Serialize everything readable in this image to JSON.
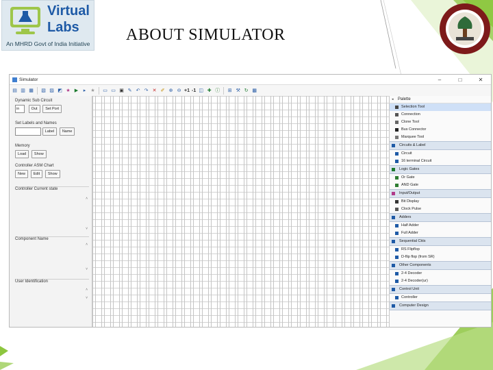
{
  "slide": {
    "title": "ABOUT SIMULATOR",
    "logo": {
      "line1": "Virtual",
      "line2": "Labs",
      "tagline": "An MHRD Govt of India Initiative"
    }
  },
  "window": {
    "title": "Simulator",
    "controls": [
      "–",
      "□",
      "✕"
    ]
  },
  "toolbar": {
    "icons": [
      "new-icon",
      "open-icon",
      "save-icon",
      "export-icon",
      "print-icon",
      "chart-icon",
      "star-icon",
      "run-icon",
      "step-icon",
      "star-outline-icon",
      "layout-icon",
      "layout2-icon",
      "grid-icon",
      "edit-icon",
      "undo-icon",
      "redo-icon",
      "delete-icon",
      "select-icon",
      "zoom-in-icon",
      "zoom-out-icon",
      "plus-one",
      "minus-one",
      "layout3-icon",
      "connect-icon",
      "info-icon",
      "align-icon",
      "tools-icon",
      "refresh-icon",
      "component-icon"
    ],
    "plus_one": "+1",
    "minus_one": "-1"
  },
  "left_panel": {
    "dynamic_sub_circuit": {
      "label": "Dynamic Sub Circuit",
      "in_value": "in",
      "out_label": "Out",
      "set_port_label": "Set Port"
    },
    "set_labels": {
      "label": "Set Labels and Names",
      "label_button": "Label",
      "name_button": "Name"
    },
    "memory": {
      "label": "Memory",
      "load_button": "Load",
      "show_button": "Show"
    },
    "controller_asm": {
      "label": "Controller ASM Chart",
      "new_button": "New",
      "edit_button": "Edit",
      "show_button": "Show"
    },
    "controller_current_state": "Controller Current state",
    "component_name": "Component Name",
    "user_identification": "User Identification"
  },
  "palette": {
    "header": "Palette",
    "rows": [
      {
        "kind": "item",
        "label": "Selection Tool",
        "selected": true,
        "icon": "pointer-icon"
      },
      {
        "kind": "item",
        "label": "Connection",
        "icon": "connection-icon"
      },
      {
        "kind": "item",
        "label": "Clone Tool",
        "icon": "clone-icon"
      },
      {
        "kind": "item",
        "label": "Bus Connector",
        "icon": "bus-icon"
      },
      {
        "kind": "item",
        "label": "Marquee Tool",
        "icon": "marquee-icon"
      },
      {
        "kind": "drawer",
        "label": "Circuits & Label",
        "icon": "circuit-icon"
      },
      {
        "kind": "item",
        "label": "Circuit",
        "icon": "circuit-icon"
      },
      {
        "kind": "item",
        "label": "16 terminal Circuit",
        "icon": "terminal-icon"
      },
      {
        "kind": "drawer",
        "label": "Logic Gates",
        "icon": "gate-icon"
      },
      {
        "kind": "item",
        "label": "Or Gate",
        "icon": "or-gate-icon"
      },
      {
        "kind": "item",
        "label": "AND Gate",
        "icon": "and-gate-icon"
      },
      {
        "kind": "drawer",
        "label": "Input/Output",
        "icon": "io-icon"
      },
      {
        "kind": "item",
        "label": "Bit Display",
        "icon": "display-icon"
      },
      {
        "kind": "item",
        "label": "Clock Pulse",
        "icon": "clock-icon"
      },
      {
        "kind": "drawer",
        "label": "Adders",
        "icon": "adder-icon"
      },
      {
        "kind": "item",
        "label": "Half Adder",
        "icon": "adder-icon"
      },
      {
        "kind": "item",
        "label": "Full Adder",
        "icon": "adder-icon"
      },
      {
        "kind": "drawer",
        "label": "Sequential Ckts",
        "icon": "seq-icon"
      },
      {
        "kind": "item",
        "label": "RS Flipflop",
        "icon": "flipflop-icon"
      },
      {
        "kind": "item",
        "label": "D-flip flop (from SR)",
        "icon": "flipflop-icon"
      },
      {
        "kind": "drawer",
        "label": "Other Components",
        "icon": "component-icon"
      },
      {
        "kind": "item",
        "label": "2-4 Decoder",
        "icon": "decoder-icon"
      },
      {
        "kind": "item",
        "label": "2-4 Decoder(ur)",
        "icon": "decoder-icon"
      },
      {
        "kind": "drawer",
        "label": "Control Unit",
        "icon": "control-icon"
      },
      {
        "kind": "item",
        "label": "Controller",
        "icon": "controller-icon"
      },
      {
        "kind": "drawer",
        "label": "Computer Design",
        "icon": "computer-icon"
      }
    ]
  },
  "colors": {
    "accent": "#8dc63f",
    "selection": "#cfe0f7",
    "drawer": "#dbe4ef",
    "brand": "#1e5aa6"
  }
}
